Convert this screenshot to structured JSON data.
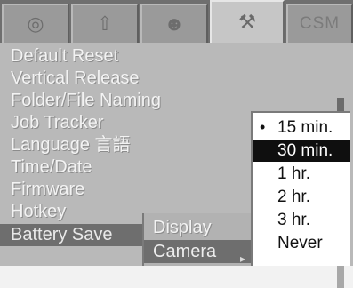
{
  "tabs": [
    {
      "icon": "camera-icon",
      "active": false
    },
    {
      "icon": "upload-icon",
      "active": false
    },
    {
      "icon": "portrait-icon",
      "active": false
    },
    {
      "icon": "wrench-icon",
      "active": true
    },
    {
      "label": "CSM",
      "active": false
    }
  ],
  "menu": {
    "items": [
      {
        "label": "Default Reset"
      },
      {
        "label": "Vertical Release"
      },
      {
        "label": "Folder/File Naming"
      },
      {
        "label": "Job Tracker"
      },
      {
        "label": "Language 言語"
      },
      {
        "label": "Time/Date"
      },
      {
        "label": "Firmware"
      },
      {
        "label": "Hotkey"
      },
      {
        "label": "Battery Save"
      }
    ],
    "selected_label": "Battery Save"
  },
  "submenu": {
    "items": [
      {
        "label": "Display"
      },
      {
        "label": "Camera"
      }
    ],
    "selected_label": "Camera"
  },
  "popup": {
    "options": [
      {
        "label": "15 min.",
        "current": true
      },
      {
        "label": "30 min.",
        "highlight": true
      },
      {
        "label": "1 hr."
      },
      {
        "label": "2 hr."
      },
      {
        "label": "3 hr."
      },
      {
        "label": "Never"
      }
    ],
    "bullet": "•"
  },
  "colors": {
    "background": "#b9b9b9",
    "selected": "#6e6e6e",
    "highlight": "#0f0f0f"
  }
}
